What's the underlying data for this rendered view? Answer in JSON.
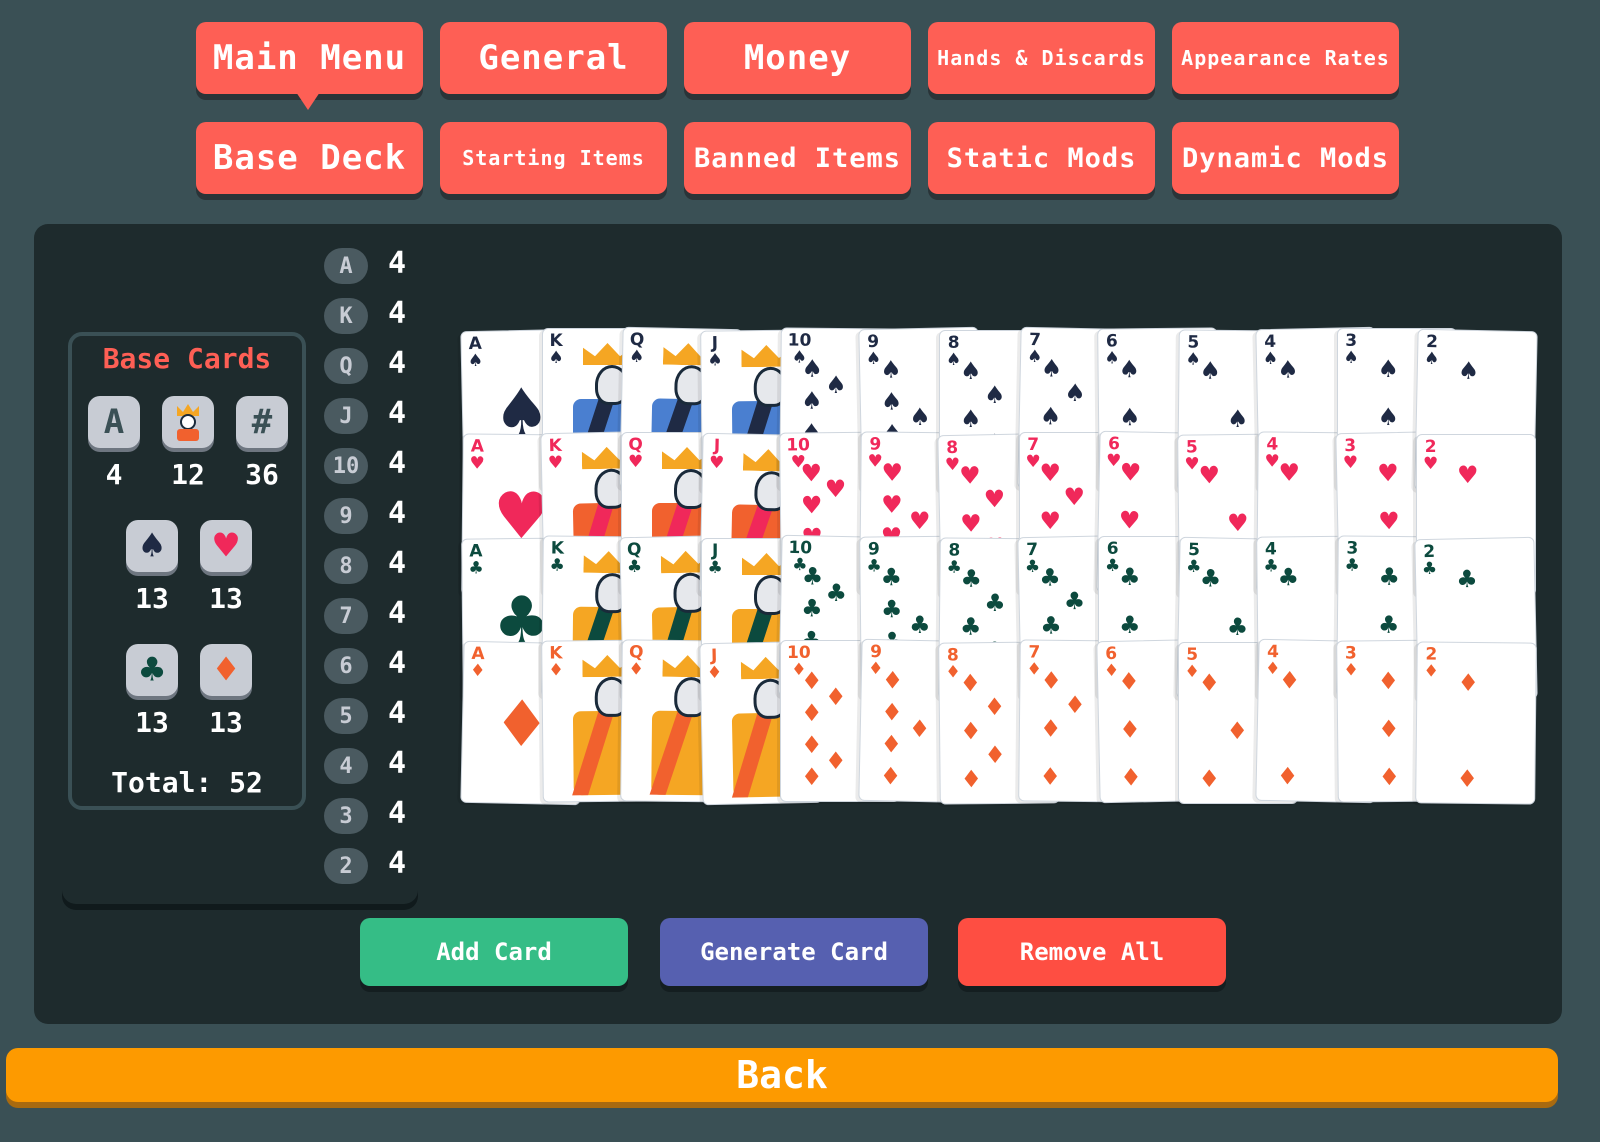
{
  "tabs_row1": [
    {
      "label": "Main Menu",
      "size": "big",
      "active": true
    },
    {
      "label": "General",
      "size": "big"
    },
    {
      "label": "Money",
      "size": "big"
    },
    {
      "label": "Hands & Discards",
      "size": "small"
    },
    {
      "label": "Appearance Rates",
      "size": "small"
    }
  ],
  "tabs_row2": [
    {
      "label": "Base Deck",
      "size": "big"
    },
    {
      "label": "Starting Items",
      "size": "small"
    },
    {
      "label": "Banned Items",
      "size": "mid"
    },
    {
      "label": "Static Mods",
      "size": "mid"
    },
    {
      "label": "Dynamic Mods",
      "size": "mid"
    }
  ],
  "base_cards": {
    "title": "Base Cards",
    "ace_icon": "A",
    "face_icon": "face-card-icon",
    "number_icon": "#",
    "ace_count": "4",
    "face_count": "12",
    "number_count": "36",
    "spades_count": "13",
    "hearts_count": "13",
    "clubs_count": "13",
    "diamonds_count": "13",
    "total": "Total: 52"
  },
  "ranks": [
    {
      "rank": "A",
      "count": "4"
    },
    {
      "rank": "K",
      "count": "4"
    },
    {
      "rank": "Q",
      "count": "4"
    },
    {
      "rank": "J",
      "count": "4"
    },
    {
      "rank": "10",
      "count": "4"
    },
    {
      "rank": "9",
      "count": "4"
    },
    {
      "rank": "8",
      "count": "4"
    },
    {
      "rank": "7",
      "count": "4"
    },
    {
      "rank": "6",
      "count": "4"
    },
    {
      "rank": "5",
      "count": "4"
    },
    {
      "rank": "4",
      "count": "4"
    },
    {
      "rank": "3",
      "count": "4"
    },
    {
      "rank": "2",
      "count": "4"
    }
  ],
  "card_ranks": [
    "A",
    "K",
    "Q",
    "J",
    "10",
    "9",
    "8",
    "7",
    "6",
    "5",
    "4",
    "3",
    "2"
  ],
  "suits": [
    {
      "name": "spades",
      "symbol": "♠",
      "color": "#1f2a44"
    },
    {
      "name": "hearts",
      "symbol": "♥",
      "color": "#f0285a"
    },
    {
      "name": "clubs",
      "symbol": "♣",
      "color": "#0c4a3e"
    },
    {
      "name": "diamonds",
      "symbol": "♦",
      "color": "#f1612e"
    }
  ],
  "actions": {
    "add_card": "Add Card",
    "generate_card": "Generate Card",
    "remove_all": "Remove All"
  },
  "back_label": "Back",
  "colors": {
    "tab": "#fe5f55",
    "add": "#35bd86",
    "generate": "#5660b0",
    "remove": "#fe4e42",
    "back": "#fd9a00"
  }
}
